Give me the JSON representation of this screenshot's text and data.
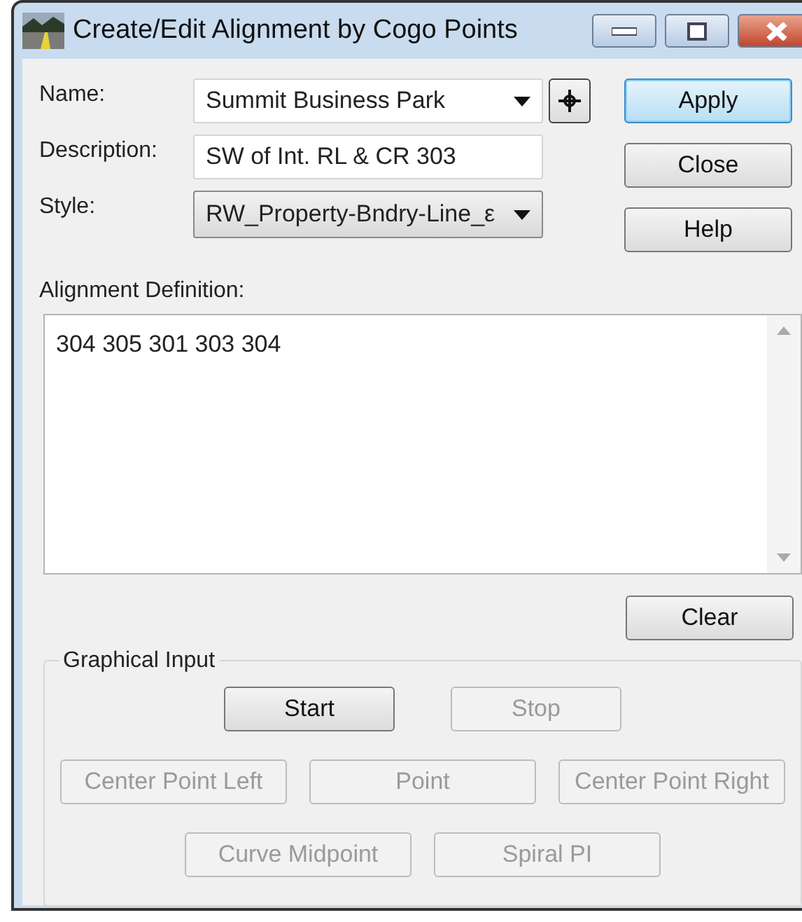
{
  "window": {
    "title": "Create/Edit Alignment by Cogo Points"
  },
  "fields": [
    {
      "label": "Name:",
      "kind": "combo",
      "value": "Summit Business Park"
    },
    {
      "label": "Description:",
      "kind": "text",
      "value": "SW of Int. RL & CR 303"
    },
    {
      "label": "Style:",
      "kind": "dropdown",
      "value": "RW_Property-Bndry-Line_ε"
    }
  ],
  "side_buttons": [
    {
      "label": "Apply",
      "default": true
    },
    {
      "label": "Close",
      "default": false
    },
    {
      "label": "Help",
      "default": false
    }
  ],
  "definition": {
    "label": "Alignment Definition:",
    "value": "304 305 301 303 304"
  },
  "clear_button": {
    "label": "Clear"
  },
  "graphical_input": {
    "title": "Graphical Input",
    "rows": [
      [
        {
          "label": "Start",
          "disabled": false
        },
        {
          "label": "Stop",
          "disabled": true
        }
      ],
      [
        {
          "label": "Center Point Left",
          "disabled": true
        },
        {
          "label": "Point",
          "disabled": true
        },
        {
          "label": "Center Point Right",
          "disabled": true
        }
      ],
      [
        {
          "label": "Curve Midpoint",
          "disabled": true
        },
        {
          "label": "Spiral PI",
          "disabled": true
        }
      ]
    ]
  }
}
